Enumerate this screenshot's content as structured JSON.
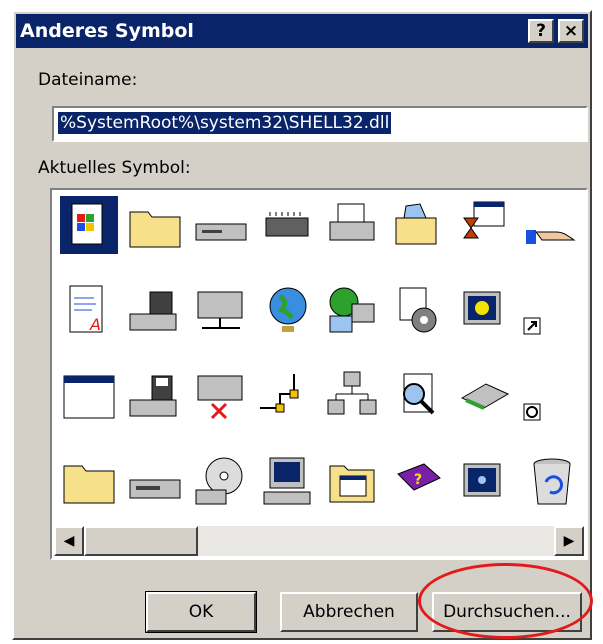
{
  "window": {
    "title": "Anderes Symbol",
    "help_glyph": "?",
    "close_glyph": "×"
  },
  "filename": {
    "label": "Dateiname:",
    "value": "%SystemRoot%\\system32\\SHELL32.dll"
  },
  "current_symbol": {
    "label": "Aktuelles Symbol:"
  },
  "icons": [
    "windows-document-icon",
    "folder-icon",
    "drive-icon",
    "chip-icon",
    "printer-icon",
    "open-folder-icon",
    "hourglass-window-icon",
    "hand-share-icon",
    "text-document-icon",
    "floppy-computer-icon",
    "network-drive-icon",
    "globe-icon",
    "network-globe-icon",
    "gear-document-icon",
    "monitor-moon-icon",
    "shortcut-arrow-icon",
    "window-icon",
    "floppy-drive-icon",
    "disconnected-drive-icon",
    "network-cable-icon",
    "network-tree-icon",
    "search-document-icon",
    "scanner-icon",
    "clock-overlay-icon",
    "empty-folder-icon",
    "cd-drive-icon",
    "cd-disc-icon",
    "computer-icon",
    "folder-window-icon",
    "help-book-icon",
    "monitor-star-icon",
    "recycle-bin-icon"
  ],
  "scrollbar": {
    "left_glyph": "◀",
    "right_glyph": "▶"
  },
  "buttons": {
    "ok": "OK",
    "cancel": "Abbrechen",
    "browse": "Durchsuchen..."
  },
  "colors": {
    "titlebar": "#0a246a",
    "annotation": "#e21a1a",
    "face": "#d4d0c8"
  }
}
